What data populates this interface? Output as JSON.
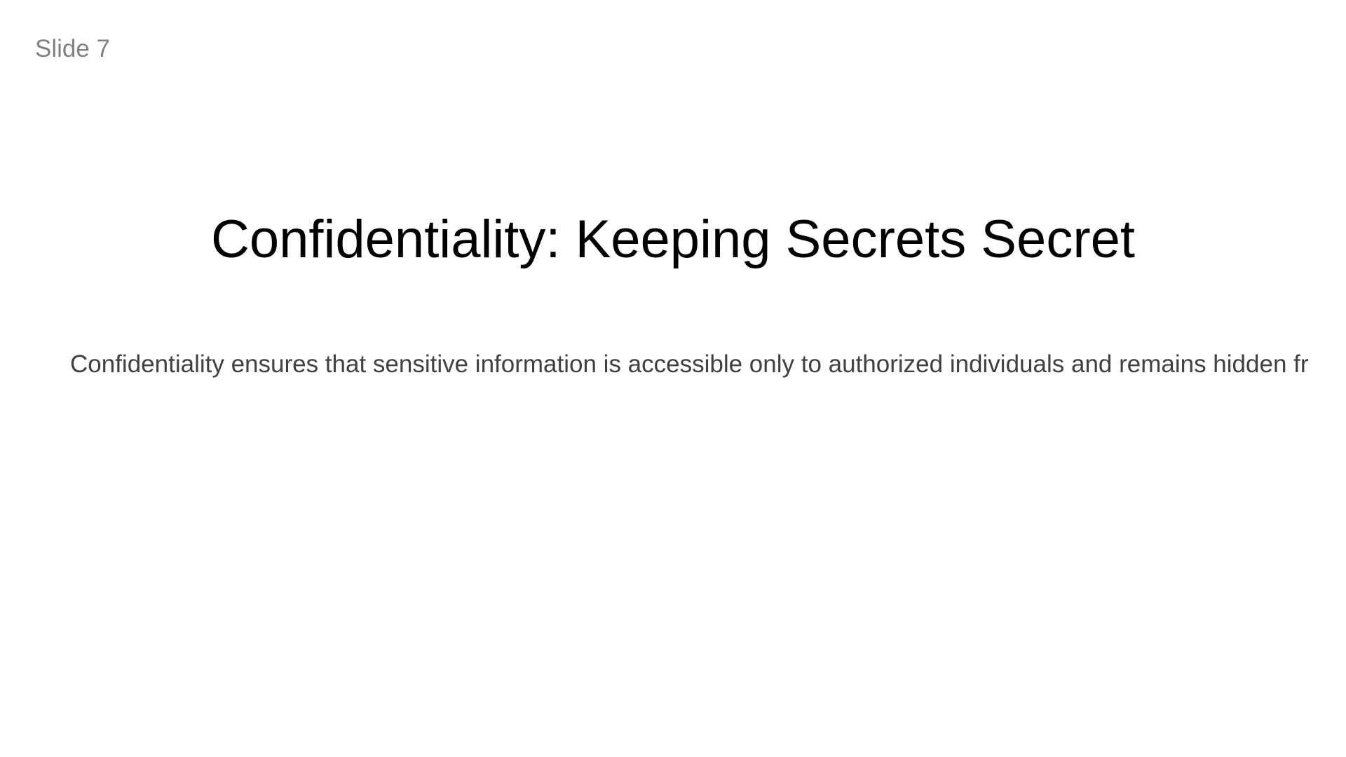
{
  "slide": {
    "number_label": "Slide 7",
    "title": "Confidentiality: Keeping Secrets Secret",
    "body": "Confidentiality ensures that sensitive information is accessible only to authorized individuals and remains hidden fr"
  },
  "colors": {
    "background": "#ffffff",
    "title": "#000000",
    "body": "#404040",
    "slide_number": "#808080"
  }
}
